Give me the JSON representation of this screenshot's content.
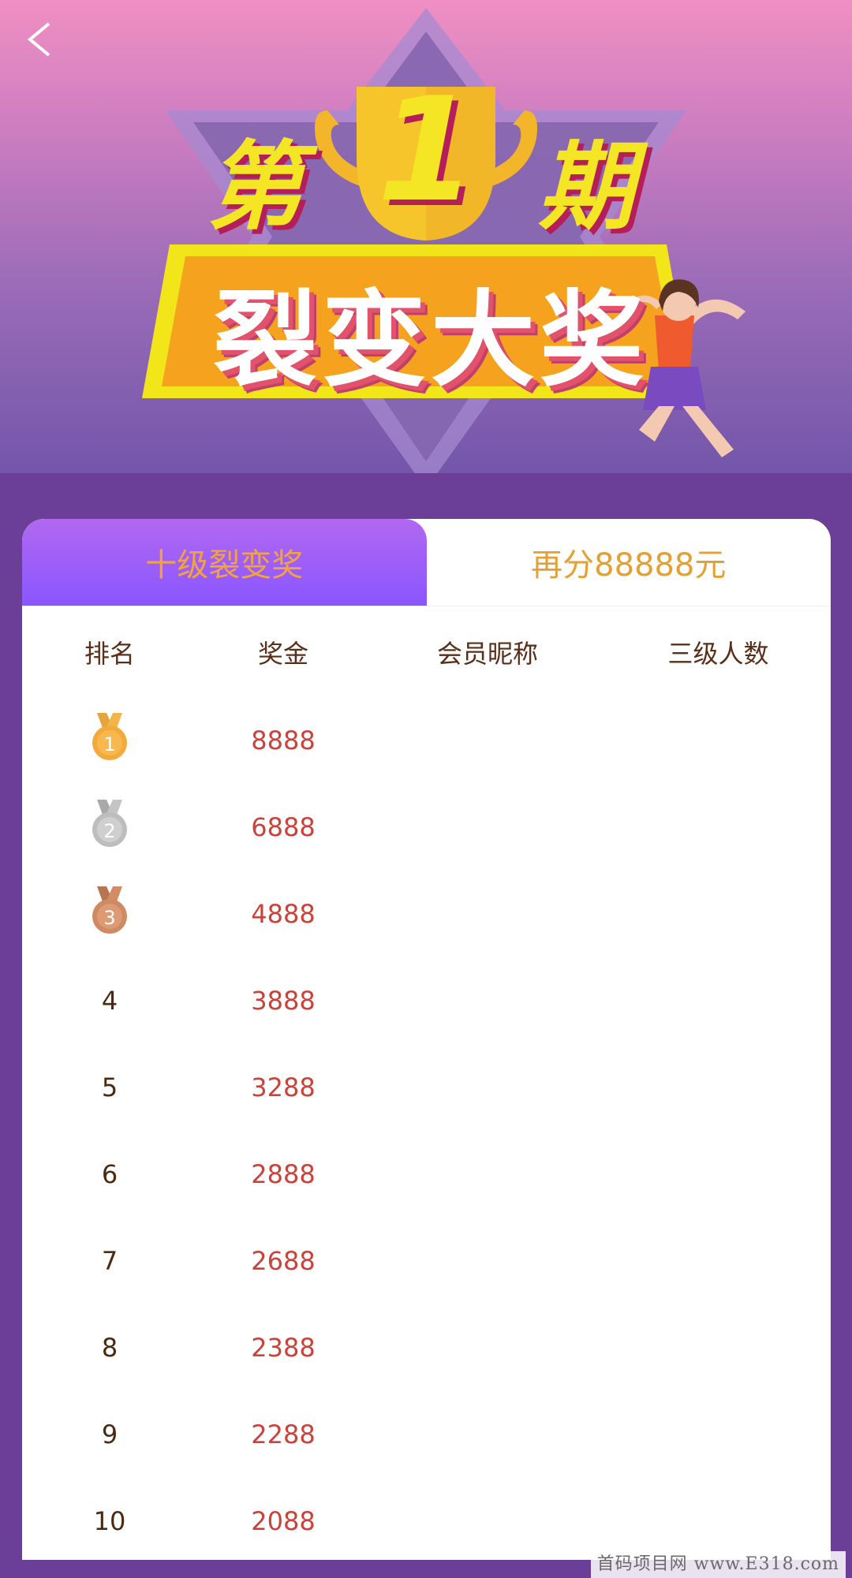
{
  "banner": {
    "period_prefix": "第",
    "period_number": "1",
    "period_suffix": "期",
    "main_title": "裂变大奖"
  },
  "tabs": [
    {
      "label": "十级裂变奖",
      "active": true
    },
    {
      "label": "再分88888元",
      "active": false
    }
  ],
  "table": {
    "headers": [
      "排名",
      "奖金",
      "会员昵称",
      "三级人数"
    ],
    "rows": [
      {
        "rank": "1",
        "amount": "8888",
        "nickname": "",
        "count": ""
      },
      {
        "rank": "2",
        "amount": "6888",
        "nickname": "",
        "count": ""
      },
      {
        "rank": "3",
        "amount": "4888",
        "nickname": "",
        "count": ""
      },
      {
        "rank": "4",
        "amount": "3888",
        "nickname": "",
        "count": ""
      },
      {
        "rank": "5",
        "amount": "3288",
        "nickname": "",
        "count": ""
      },
      {
        "rank": "6",
        "amount": "2888",
        "nickname": "",
        "count": ""
      },
      {
        "rank": "7",
        "amount": "2688",
        "nickname": "",
        "count": ""
      },
      {
        "rank": "8",
        "amount": "2388",
        "nickname": "",
        "count": ""
      },
      {
        "rank": "9",
        "amount": "2288",
        "nickname": "",
        "count": ""
      },
      {
        "rank": "10",
        "amount": "2088",
        "nickname": "",
        "count": ""
      }
    ]
  },
  "medals": {
    "gold": "#f4a93b",
    "silver": "#c0c0c0",
    "bronze": "#cf8a62"
  },
  "icons": {
    "back": "chevron-left-icon",
    "trophy": "trophy-icon",
    "medal": "medal-icon"
  },
  "colors": {
    "background": "#6b3f98",
    "tab_active_start": "#b168f0",
    "tab_active_end": "#8a56ff",
    "tab_text": "#e5a033",
    "amount": "#c8433b",
    "rank_text": "#4a2a12"
  },
  "watermark": "首码项目网 www.E318.com"
}
